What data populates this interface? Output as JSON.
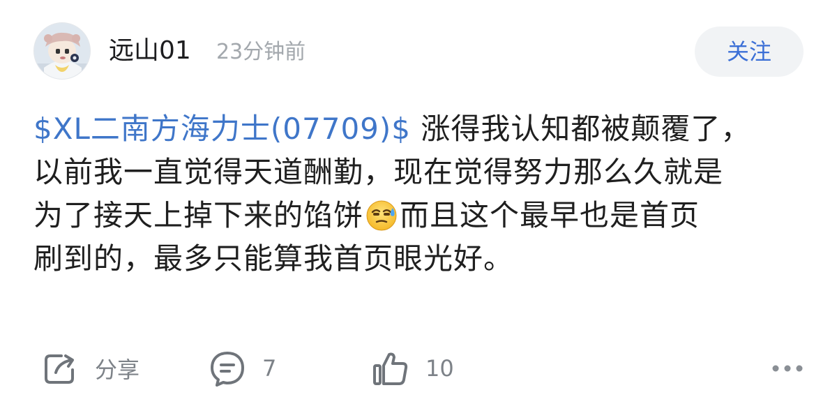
{
  "user": {
    "name": "远山01",
    "time": "23分钟前",
    "follow_label": "关注"
  },
  "post": {
    "stock_tag": "$XL二南方海力士(07709)$",
    "line1_text": " 涨得我认知都被颠覆了，",
    "line2": "以前我一直觉得天道酬勤，现在觉得努力那么久就是",
    "line3_before": "为了接天上掉下来的馅饼",
    "line3_after": "而且这个最早也是首页",
    "line4": "刷到的，最多只能算我首页眼光好。",
    "emoji": "sweat-smile-icon"
  },
  "actions": {
    "share_label": "分享",
    "comment_count": "7",
    "like_count": "10"
  },
  "colors": {
    "accent": "#3f76c9",
    "follow_text": "#3b6fd6",
    "muted": "#a3a8ad",
    "icon": "#6f747a"
  }
}
